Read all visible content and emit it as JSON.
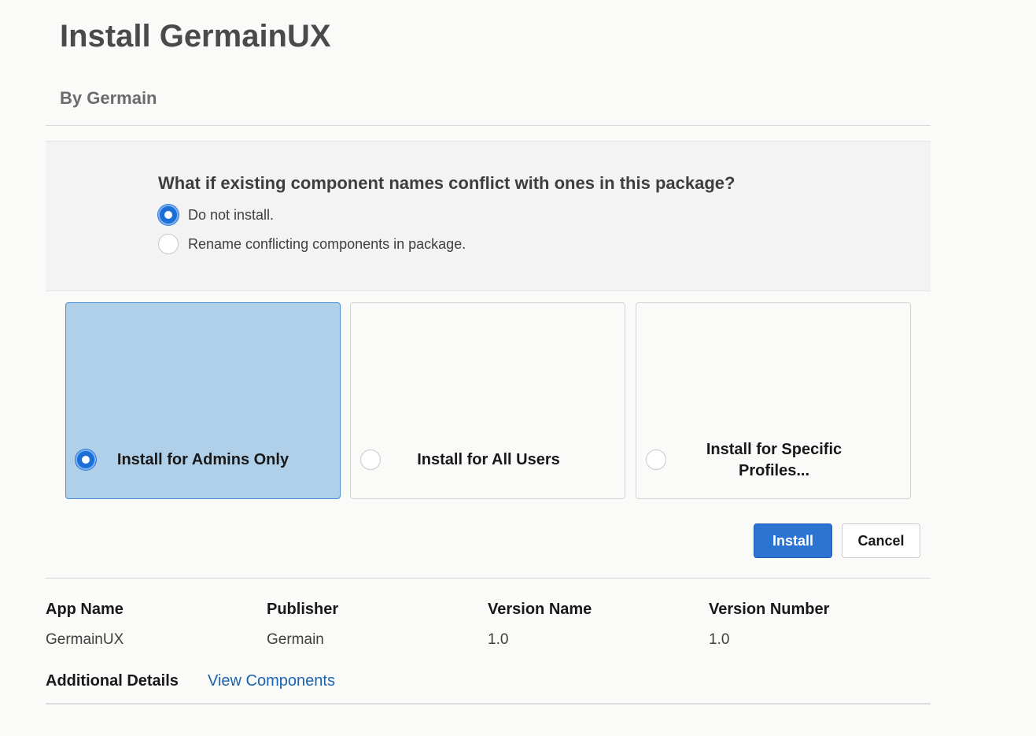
{
  "header": {
    "title": "Install GermainUX",
    "byline": "By Germain"
  },
  "conflict": {
    "question": "What if existing component names conflict with ones in this package?",
    "options": [
      {
        "label": "Do not install.",
        "selected": true
      },
      {
        "label": "Rename conflicting components in package.",
        "selected": false
      }
    ]
  },
  "install_options": [
    {
      "label": "Install for Admins Only",
      "selected": true
    },
    {
      "label": "Install for All Users",
      "selected": false
    },
    {
      "label": "Install for Specific Profiles...",
      "selected": false
    }
  ],
  "buttons": {
    "install": "Install",
    "cancel": "Cancel"
  },
  "meta": {
    "columns": [
      {
        "header": "App Name",
        "value": "GermainUX"
      },
      {
        "header": "Publisher",
        "value": "Germain"
      },
      {
        "header": "Version Name",
        "value": "1.0"
      },
      {
        "header": "Version Number",
        "value": "1.0"
      }
    ],
    "additional_details_label": "Additional Details",
    "view_components_link": "View Components"
  },
  "colors": {
    "primary": "#2b74d2",
    "selected_card": "#b0cfe9",
    "link": "#1a63b0"
  }
}
